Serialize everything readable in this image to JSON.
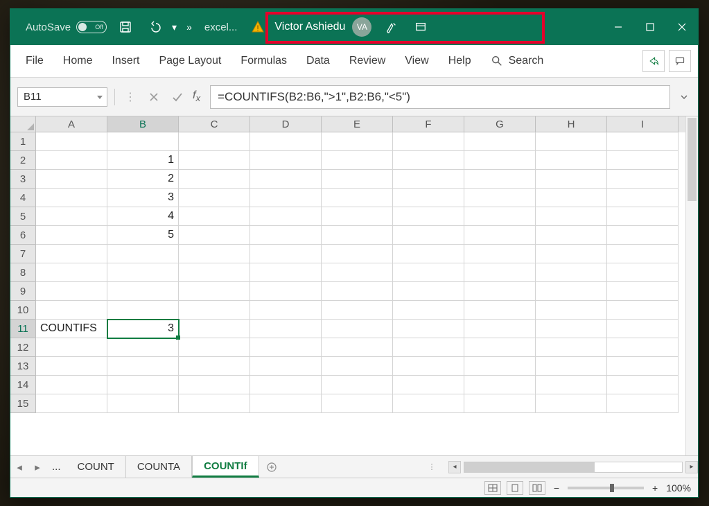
{
  "titlebar": {
    "autosave_label": "AutoSave",
    "autosave_state": "Off",
    "doc_title": "excel...",
    "user_name": "Victor Ashiedu",
    "user_initials": "VA"
  },
  "ribbon": {
    "tabs": [
      "File",
      "Home",
      "Insert",
      "Page Layout",
      "Formulas",
      "Data",
      "Review",
      "View",
      "Help"
    ],
    "search_label": "Search"
  },
  "formula_bar": {
    "namebox": "B11",
    "formula": "=COUNTIFS(B2:B6,\">1\",B2:B6,\"<5\")"
  },
  "grid": {
    "columns": [
      "A",
      "B",
      "C",
      "D",
      "E",
      "F",
      "G",
      "H",
      "I"
    ],
    "rows": [
      {
        "n": 1,
        "cells": {}
      },
      {
        "n": 2,
        "cells": {
          "B": "1"
        }
      },
      {
        "n": 3,
        "cells": {
          "B": "2"
        }
      },
      {
        "n": 4,
        "cells": {
          "B": "3"
        }
      },
      {
        "n": 5,
        "cells": {
          "B": "4"
        }
      },
      {
        "n": 6,
        "cells": {
          "B": "5"
        }
      },
      {
        "n": 7,
        "cells": {}
      },
      {
        "n": 8,
        "cells": {}
      },
      {
        "n": 9,
        "cells": {}
      },
      {
        "n": 10,
        "cells": {}
      },
      {
        "n": 11,
        "cells": {
          "A": "COUNTIFS",
          "B": "3"
        }
      },
      {
        "n": 12,
        "cells": {}
      },
      {
        "n": 13,
        "cells": {}
      },
      {
        "n": 14,
        "cells": {}
      },
      {
        "n": 15,
        "cells": {}
      }
    ],
    "selected_cell": "B11",
    "selected_col": "B",
    "selected_row": 11
  },
  "sheet_tabs": {
    "ellipsis": "...",
    "tabs": [
      "COUNT",
      "COUNTA",
      "COUNTIf"
    ],
    "active": "COUNTIf"
  },
  "statusbar": {
    "zoom": "100%"
  }
}
